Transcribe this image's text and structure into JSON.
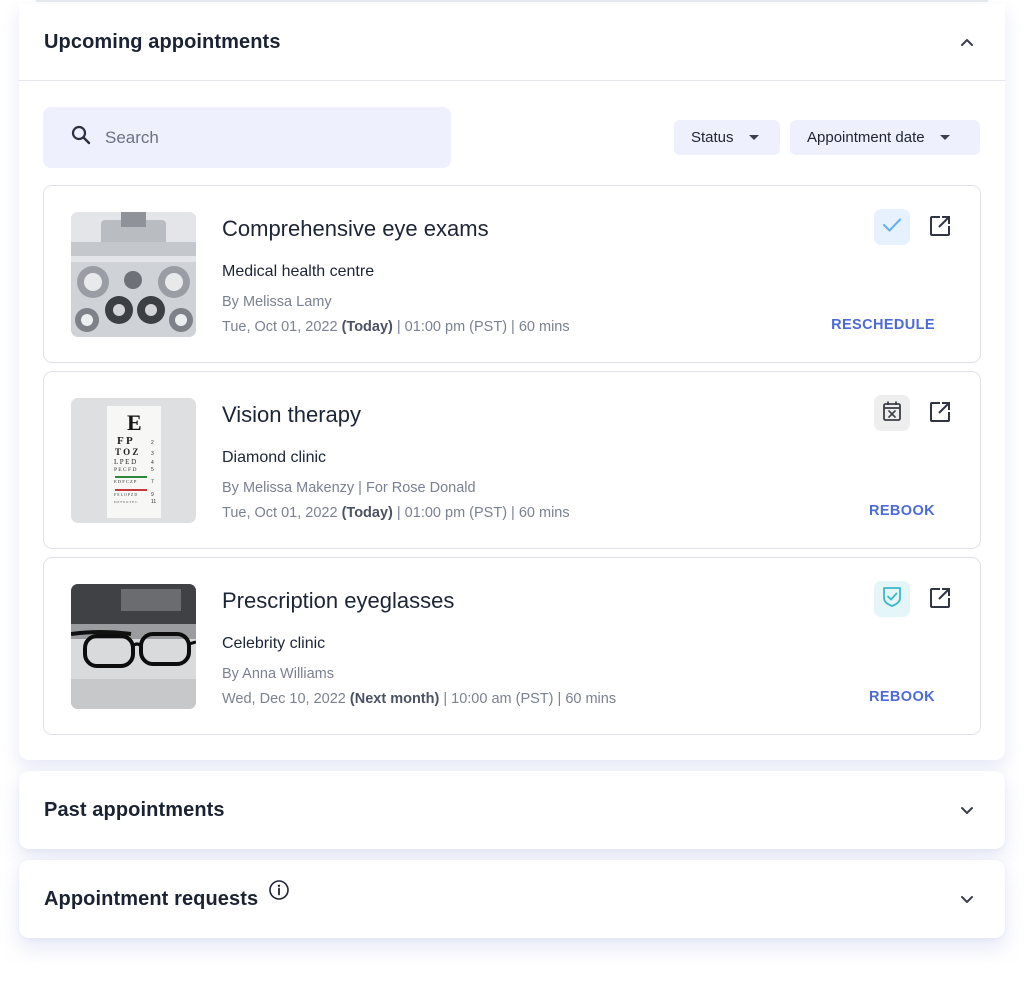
{
  "upcoming": {
    "title": "Upcoming appointments",
    "search_placeholder": "Search",
    "filters": {
      "status": "Status",
      "date": "Appointment date"
    },
    "appointments": [
      {
        "title": "Comprehensive eye exams",
        "clinic": "Medical health centre",
        "by": "By Melissa Lamy",
        "date": "Tue, Oct 01, 2022",
        "relative": "(Today)",
        "time": "| 01:00 pm (PST) | 60 mins",
        "action": "RESCHEDULE",
        "status_icon": "check-icon",
        "status_color": "#e6f1fd"
      },
      {
        "title": "Vision therapy",
        "clinic": "Diamond clinic",
        "by": "By Melissa Makenzy | For Rose Donald",
        "date": "Tue, Oct 01, 2022",
        "relative": "(Today)",
        "time": "| 01:00 pm (PST) | 60 mins",
        "action": "REBOOK",
        "status_icon": "calendar-cancel-icon",
        "status_color": "#eeeeee"
      },
      {
        "title": "Prescription eyeglasses",
        "clinic": "Celebrity clinic",
        "by": "By Anna Williams",
        "date": "Wed, Dec 10, 2022",
        "relative": "(Next month)",
        "time": "| 10:00 am (PST) | 60 mins",
        "action": "REBOOK",
        "status_icon": "shield-check-icon",
        "status_color": "#e4f6f8"
      }
    ]
  },
  "past": {
    "title": "Past appointments"
  },
  "requests": {
    "title": "Appointment requests"
  },
  "colors": {
    "accent": "#4d6bd6",
    "chip_bg": "#eef1fd",
    "text": "#1c2536",
    "muted": "#7a8190"
  }
}
